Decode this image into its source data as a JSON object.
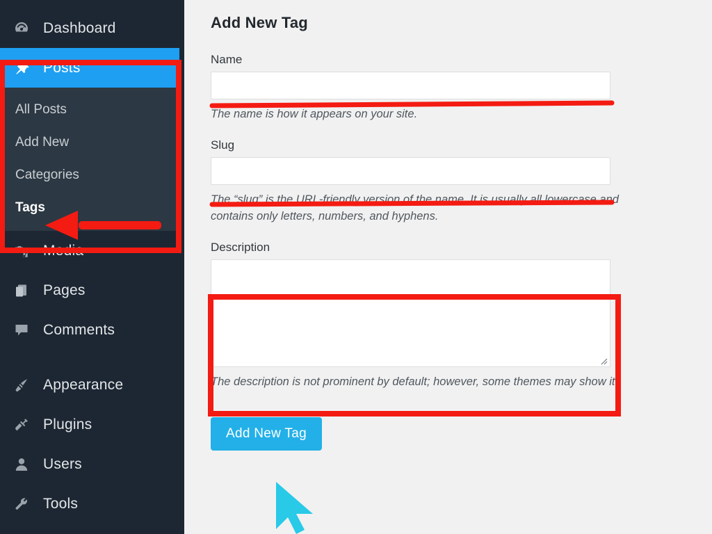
{
  "sidebar": {
    "items": [
      {
        "label": "Dashboard",
        "icon": "dashboard-gauge-icon",
        "state": "normal"
      },
      {
        "label": "Posts",
        "icon": "pin-icon",
        "state": "current"
      },
      {
        "label": "Media",
        "icon": "media-camera-icon",
        "state": "normal"
      },
      {
        "label": "Pages",
        "icon": "pages-stack-icon",
        "state": "normal"
      },
      {
        "label": "Comments",
        "icon": "comment-bubble-icon",
        "state": "normal"
      },
      {
        "label": "Appearance",
        "icon": "paintbrush-icon",
        "state": "normal"
      },
      {
        "label": "Plugins",
        "icon": "plug-icon",
        "state": "normal"
      },
      {
        "label": "Users",
        "icon": "user-icon",
        "state": "normal"
      },
      {
        "label": "Tools",
        "icon": "wrench-icon",
        "state": "normal"
      }
    ],
    "submenu": [
      {
        "label": "All Posts",
        "active": false
      },
      {
        "label": "Add New",
        "active": false
      },
      {
        "label": "Categories",
        "active": false
      },
      {
        "label": "Tags",
        "active": true
      }
    ]
  },
  "main": {
    "page_title": "Add New Tag",
    "fields": {
      "name": {
        "label": "Name",
        "value": "",
        "placeholder": "",
        "help": "The name is how it appears on your site."
      },
      "slug": {
        "label": "Slug",
        "value": "",
        "placeholder": "",
        "help": "The “slug” is the URL-friendly version of the name. It is usually all lowercase and contains only letters, numbers, and hyphens."
      },
      "description": {
        "label": "Description",
        "value": "",
        "placeholder": "",
        "help": "The description is not prominent by default; however, some themes may show it."
      }
    },
    "submit_label": "Add New Tag"
  },
  "annotations": {
    "highlight_color": "#f41b12",
    "cursor_color": "#29c9e8",
    "posts_box_label": "red-box-around-posts-menu",
    "tags_arrow_label": "red-arrow-pointing-to-tags",
    "name_underline_label": "red-underline-under-name-input",
    "slug_underline_label": "red-underline-under-slug-input",
    "description_box_label": "red-box-around-description-textarea"
  },
  "colors": {
    "sidebar_bg": "#1d2733",
    "submenu_bg": "#2c3843",
    "current_item_bg": "#1e9ff2",
    "main_bg": "#f1f1f1",
    "button_bg": "#23b0e8",
    "annotation_red": "#f41b12",
    "cursor_cyan": "#29c9e8"
  }
}
